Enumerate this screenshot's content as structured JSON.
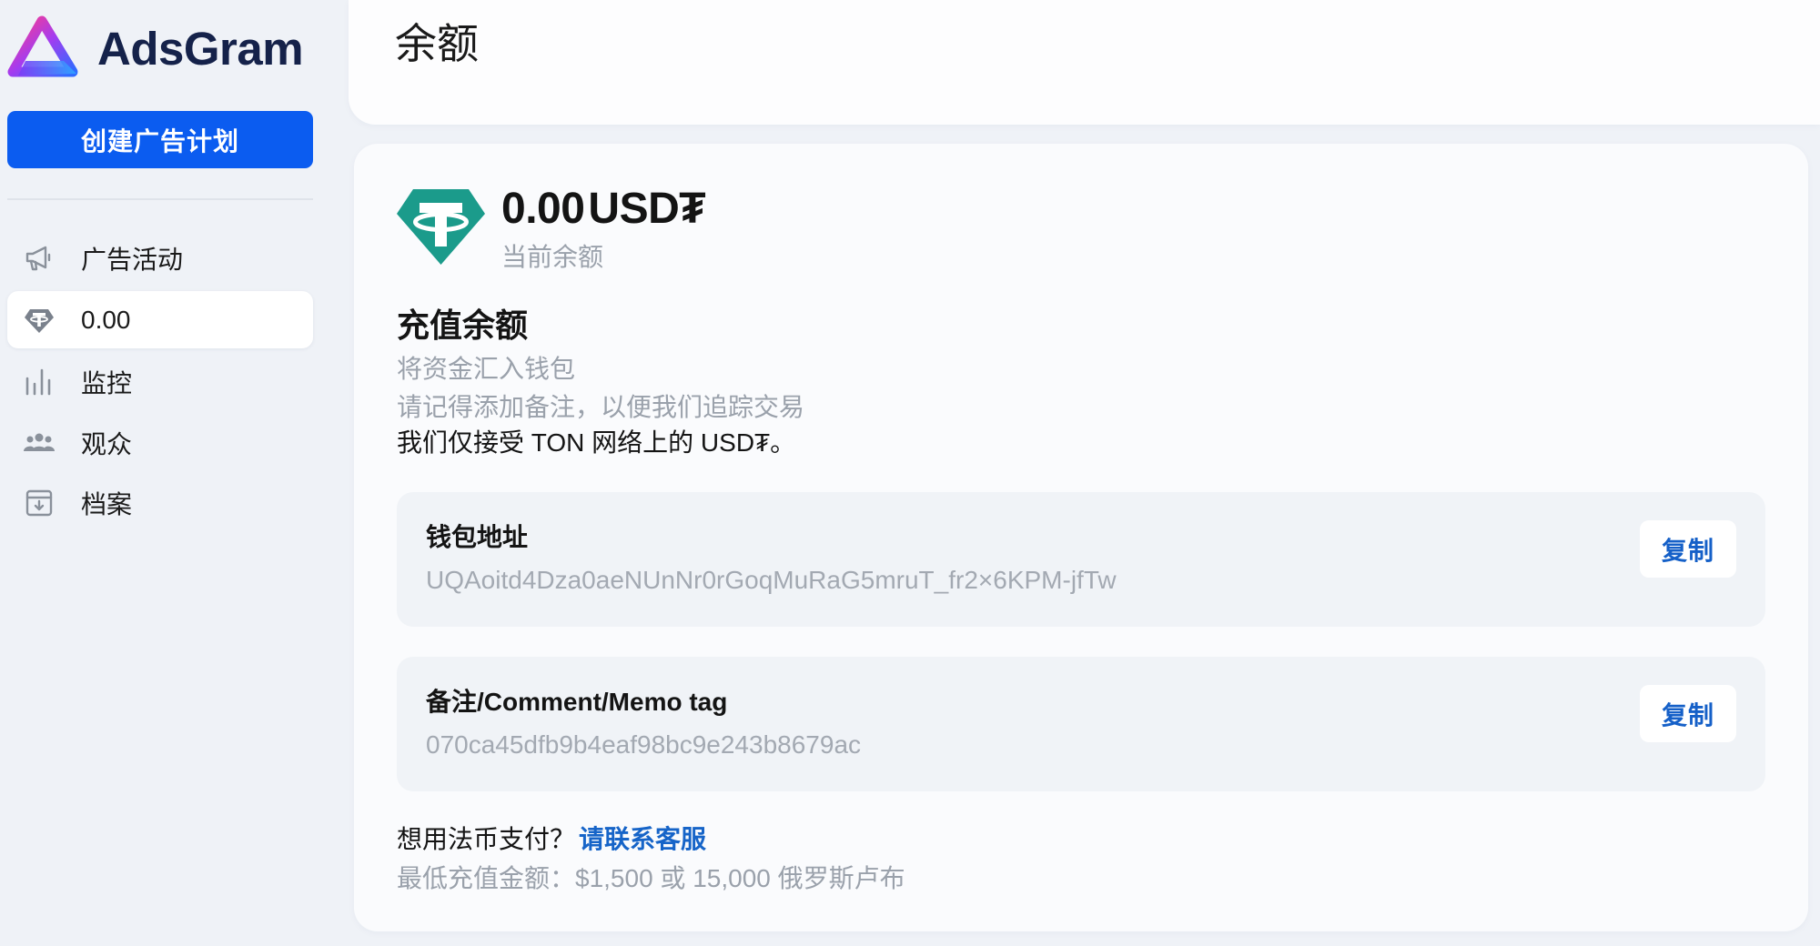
{
  "brand": {
    "name": "AdsGram",
    "icon": "adsgram-logo-icon"
  },
  "sidebar": {
    "create_button": "创建广告计划",
    "items": [
      {
        "label": "广告活动",
        "icon": "megaphone-icon",
        "active": false
      },
      {
        "label": "0.00",
        "icon": "tether-icon",
        "active": true
      },
      {
        "label": "监控",
        "icon": "bar-chart-icon",
        "active": false
      },
      {
        "label": "观众",
        "icon": "users-icon",
        "active": false
      },
      {
        "label": "档案",
        "icon": "archive-icon",
        "active": false
      }
    ]
  },
  "header": {
    "title": "余额"
  },
  "balance": {
    "amount": "0.00",
    "currency": "USD₮",
    "caption": "当前余额",
    "icon": "tether-logo-icon"
  },
  "topup": {
    "title": "充值余额",
    "line1": "将资金汇入钱包",
    "line2": "请记得添加备注，以便我们追踪交易",
    "line3": "我们仅接受 TON 网络上的 USD₮。"
  },
  "wallet": {
    "label": "钱包地址",
    "value": "UQAoitd4Dza0aeNUnNr0rGoqMuRaG5mruT_fr2×6KPM-jfTw",
    "copy_label": "复制"
  },
  "memo": {
    "label": "备注/Comment/Memo tag",
    "value": "070ca45dfb9b4eaf98bc9e243b8679ac",
    "copy_label": "复制"
  },
  "fiat": {
    "question": "想用法币支付？",
    "link": "请联系客服",
    "min_amount": "最低充值金额：$1,500 或 15,000 俄罗斯卢布"
  },
  "colors": {
    "accent": "#0b5cf0",
    "link": "#1664c8",
    "tether": "#1b9b8b",
    "page_bg": "#eff2f7",
    "muted_text": "#9aa1ab"
  }
}
